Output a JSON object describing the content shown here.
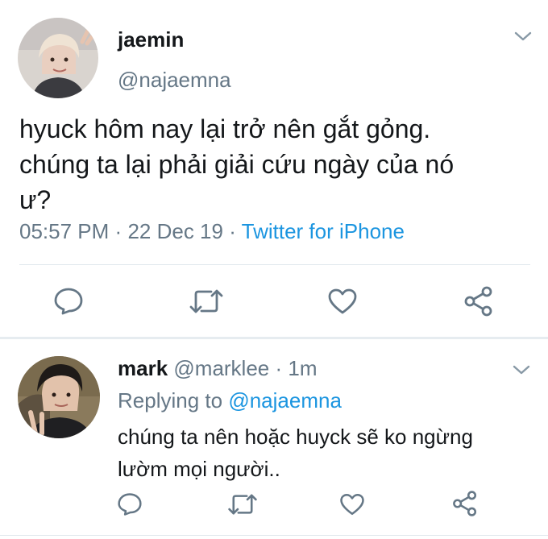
{
  "main_tweet": {
    "display_name": "jaemin",
    "handle": "@najaemna",
    "text_lines": [
      "hyuck hôm nay lại trở nên gắt gỏng.",
      "chúng ta lại phải giải cứu ngày của nó",
      "ư?"
    ],
    "time": "05:57 PM",
    "sep1": "·",
    "date": "22 Dec 19",
    "sep2": "·",
    "source": "Twitter for iPhone"
  },
  "reply": {
    "display_name": "mark",
    "handle": "@marklee",
    "sep": "·",
    "age": "1m",
    "replying_prefix": "Replying to",
    "replying_to": "@najaemna",
    "text_lines": [
      "chúng ta nên hoặc huyck sẽ ko ngừng",
      "lườm mọi người.."
    ]
  },
  "icons": {
    "reply": "reply-icon",
    "retweet": "retweet-icon",
    "like": "heart-icon",
    "share": "share-icon",
    "menu": "chevron-down-icon"
  },
  "colors": {
    "text": "#14171a",
    "muted": "#657786",
    "link": "#1b95e0",
    "divider": "#e1e8ed"
  }
}
